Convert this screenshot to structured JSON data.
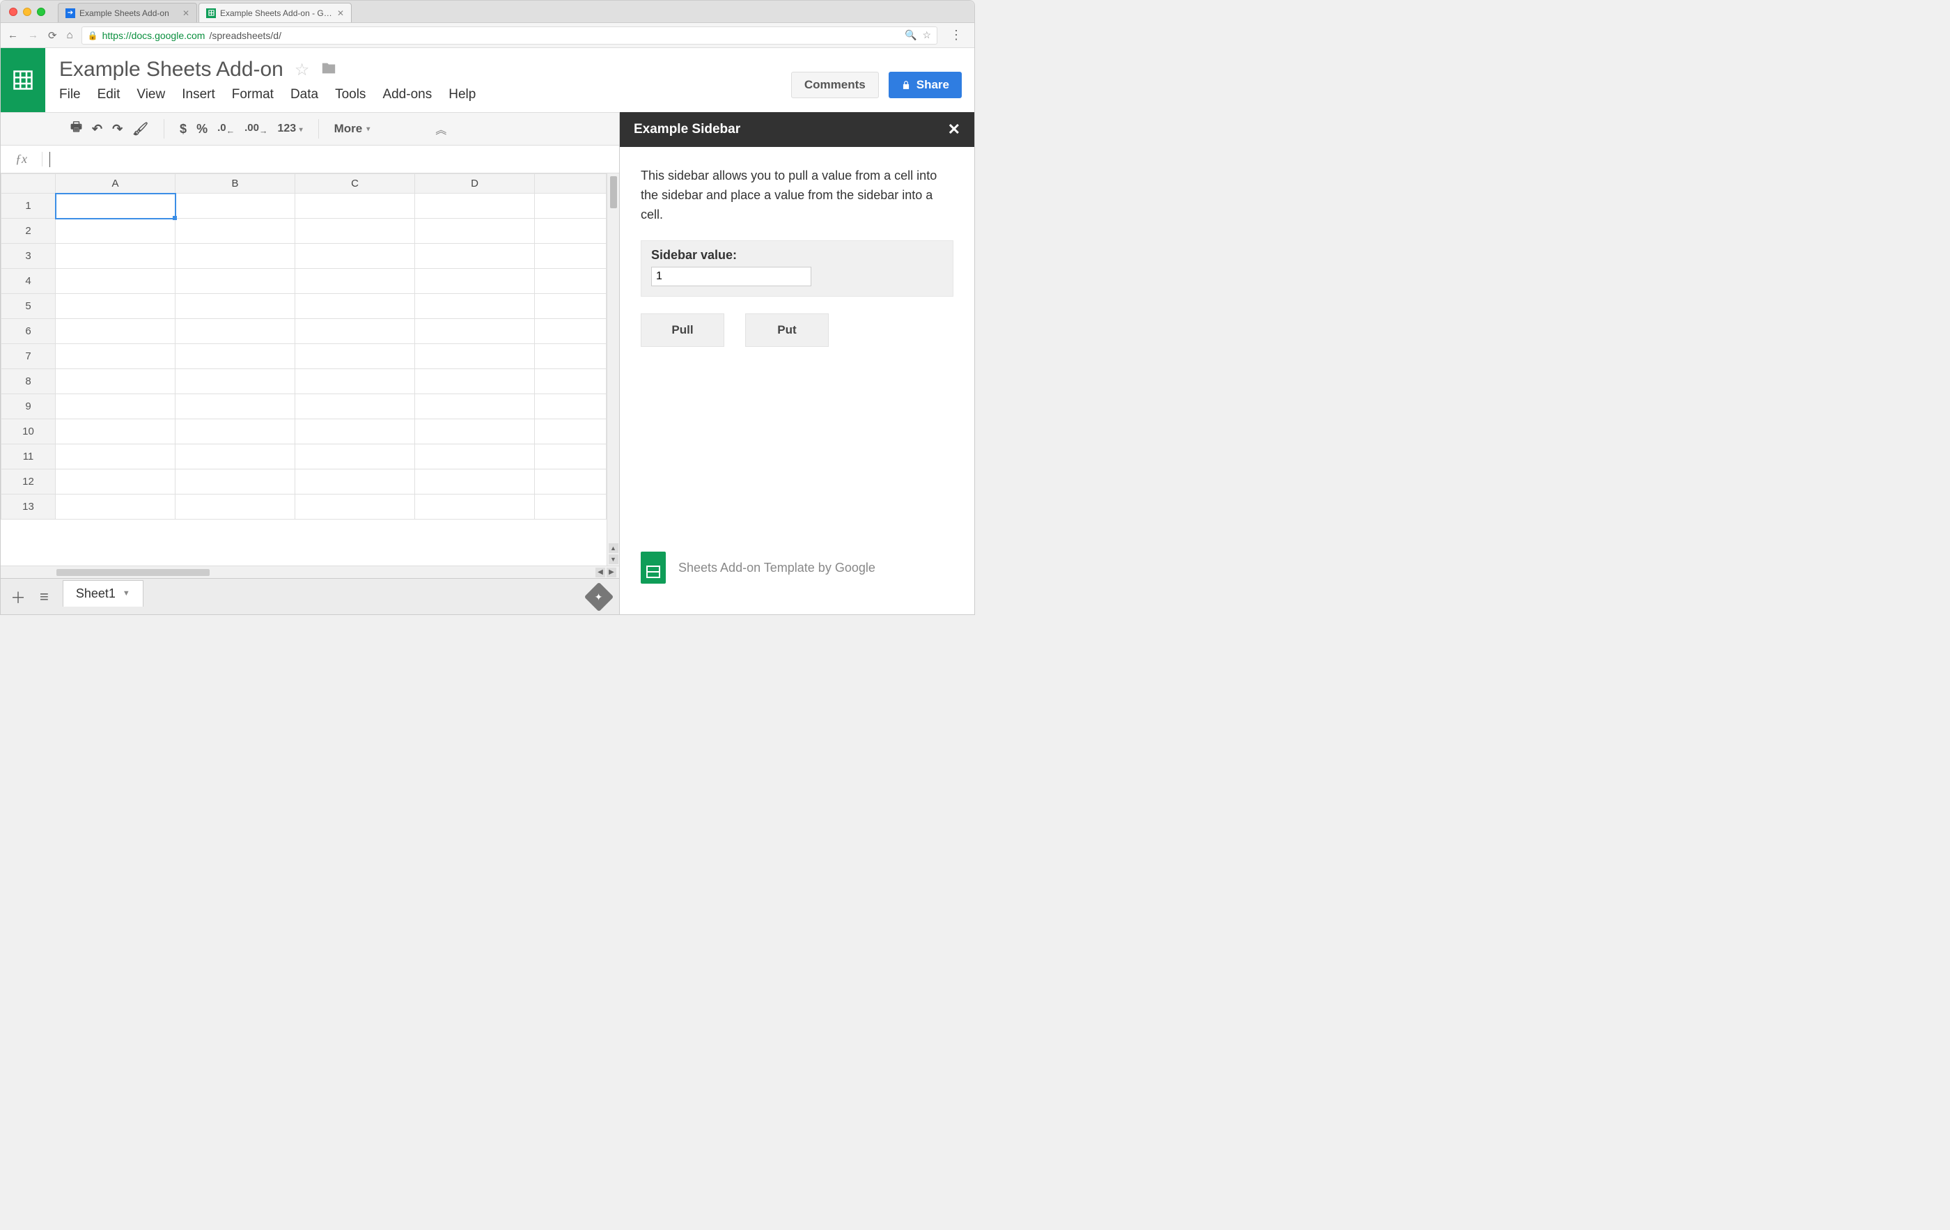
{
  "browser": {
    "tabs": [
      {
        "label": "Example Sheets Add-on"
      },
      {
        "label": "Example Sheets Add-on - Goo…"
      }
    ],
    "url_host": "https://docs.google.com",
    "url_path": "/spreadsheets/d/"
  },
  "doc": {
    "title": "Example Sheets Add-on",
    "menus": [
      "File",
      "Edit",
      "View",
      "Insert",
      "Format",
      "Data",
      "Tools",
      "Add-ons",
      "Help"
    ],
    "comments_btn": "Comments",
    "share_btn": "Share"
  },
  "toolbar": {
    "currency": "$",
    "percent": "%",
    "dec_dec": ".0",
    "inc_dec": ".00",
    "numfmt": "123",
    "more": "More"
  },
  "grid": {
    "cols": [
      "A",
      "B",
      "C",
      "D",
      ""
    ],
    "rows": [
      "1",
      "2",
      "3",
      "4",
      "5",
      "6",
      "7",
      "8",
      "9",
      "10",
      "11",
      "12",
      "13"
    ]
  },
  "sidebar": {
    "title": "Example Sidebar",
    "description": "This sidebar allows you to pull a value from a cell into the sidebar and place a value from the sidebar into a cell.",
    "field_label": "Sidebar value:",
    "field_value": "1",
    "pull": "Pull",
    "put": "Put",
    "footer": "Sheets Add-on Template by Google"
  },
  "tabstrip": {
    "sheet_name": "Sheet1"
  }
}
